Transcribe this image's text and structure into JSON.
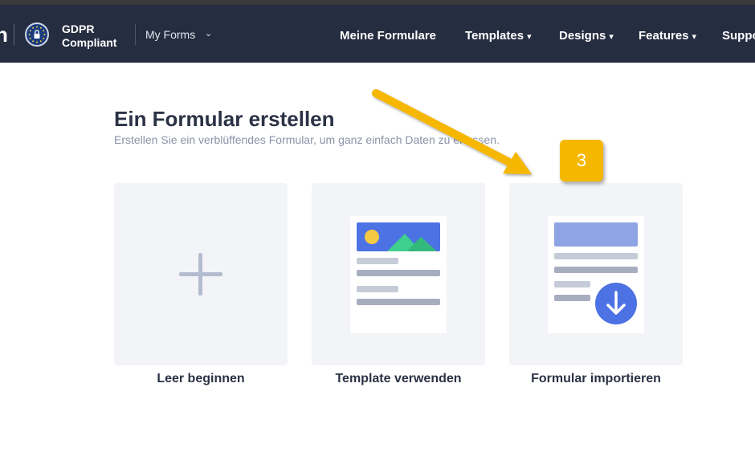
{
  "header": {
    "logo_fragment": "n",
    "gdpr_line1": "GDPR",
    "gdpr_line2": "Compliant",
    "my_forms": "My Forms",
    "nav": [
      {
        "label": "Meine Formulare",
        "caret": ""
      },
      {
        "label": "Templates",
        "caret": "▾"
      },
      {
        "label": "Designs",
        "caret": "▾"
      },
      {
        "label": "Features",
        "caret": "▾"
      },
      {
        "label": "Suppo",
        "caret": ""
      }
    ]
  },
  "main": {
    "title": "Ein Formular erstellen",
    "subtitle": "Erstellen Sie ein verblüffendes Formular, um ganz einfach Daten zu erfassen.",
    "cards": [
      {
        "label": "Leer beginnen"
      },
      {
        "label": "Template verwenden"
      },
      {
        "label": "Formular importieren"
      }
    ]
  },
  "annotation": {
    "step_number": "3",
    "color": "#f6b700"
  },
  "icons": [
    "gdpr-eu-lock-icon",
    "chevron-down-icon",
    "plus-icon",
    "template-image-icon",
    "download-arrow-icon",
    "annotation-arrow-icon"
  ],
  "colors": {
    "navbar": "#252d40",
    "card_bg": "#f3f4f8",
    "accent_blue": "#4d72e3",
    "green": "#3fcf8e",
    "sun": "#f6c945"
  }
}
